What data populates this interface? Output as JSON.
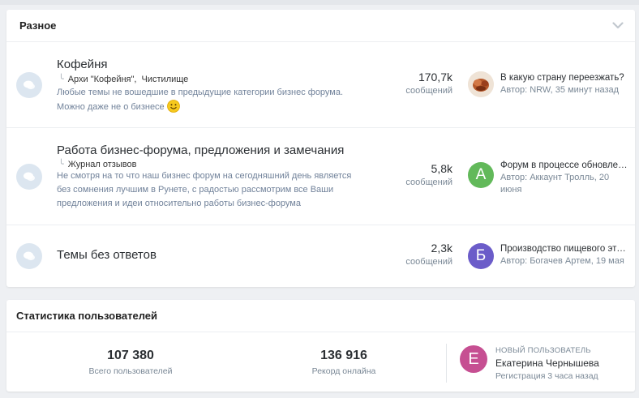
{
  "forums_panel": {
    "title": "Разное",
    "collapse_icon": "chevron-down-icon",
    "rows": [
      {
        "name": "Кофейня",
        "sublinks": [
          "Архи \"Кофейня\",",
          "Чистилище"
        ],
        "description": "Любые темы не вошедшие в предыдущие категории бизнес форума. Можно даже не о бизнесе",
        "count": "170,7k",
        "count_label": "сообщений",
        "latest_title": "В какую страну переезжать?",
        "latest_meta": "Автор: NRW, 35 минут назад",
        "avatar_letter": "",
        "avatar_color": "#c8a07a"
      },
      {
        "name": "Работа бизнес-форума, предложения и замечания",
        "sublinks": [
          "Журнал отзывов"
        ],
        "description": "Не смотря на то что наш бизнес форум на сегодняшний день является без сомнения лучшим в Рунете, с радостью рассмотрим все Ваши предложения и идеи относительно работы бизнес-форума",
        "count": "5,8k",
        "count_label": "сообщений",
        "latest_title": "Форум в процессе обновления",
        "latest_meta": "Автор: Аккаунт Тролль, 20 июня",
        "avatar_letter": "А",
        "avatar_color": "#62b95a"
      },
      {
        "name": "Темы без ответов",
        "sublinks": [],
        "description": "",
        "count": "2,3k",
        "count_label": "сообщений",
        "latest_title": "Производство пищевого этанола",
        "latest_meta": "Автор: Богачев Артем, 19 мая",
        "avatar_letter": "Б",
        "avatar_color": "#6b5cc9"
      }
    ]
  },
  "stats_panel": {
    "title": "Статистика пользователей",
    "total_users": "107 380",
    "total_users_label": "Всего пользователей",
    "record_online": "136 916",
    "record_online_label": "Рекорд онлайна",
    "new_user_caption": "НОВЫЙ ПОЛЬЗОВАТЕЛЬ",
    "new_user_name": "Екатерина Чернышева",
    "new_user_registered": "Регистрация 3 часа назад",
    "new_user_letter": "Е",
    "new_user_color": "#c64f92"
  }
}
